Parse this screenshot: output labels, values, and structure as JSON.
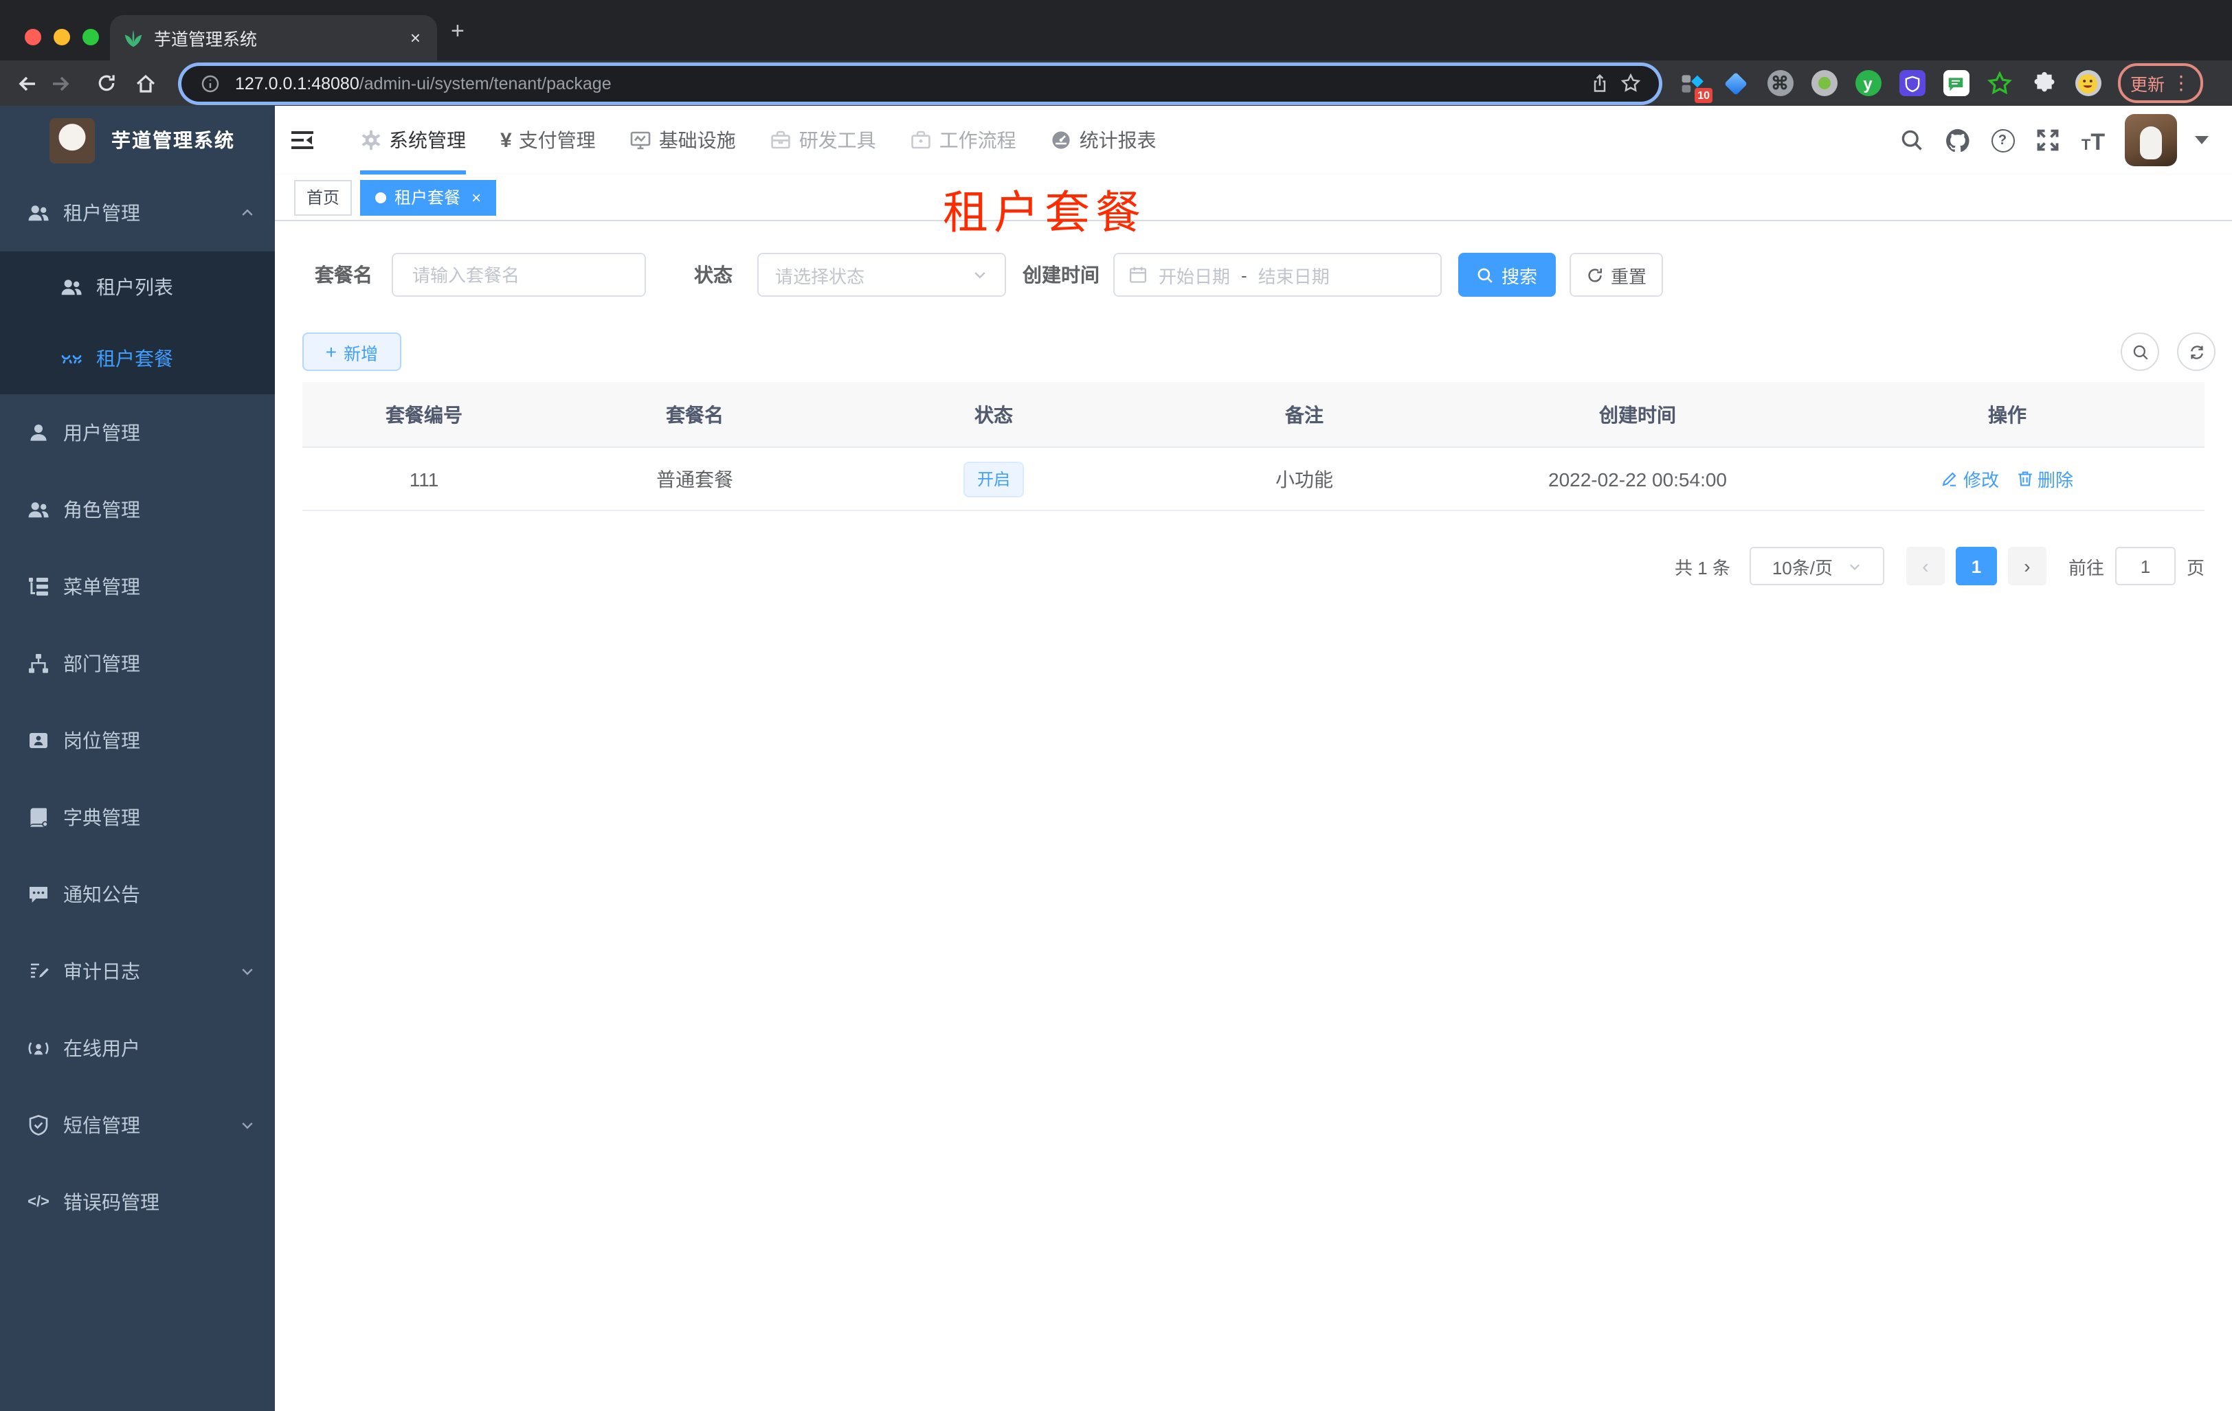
{
  "browser": {
    "tab_title": "芋道管理系统",
    "url": {
      "host": "127.0.0.1:48080",
      "path": "/admin-ui/system/tenant/package"
    },
    "update_button": "更新",
    "extension_badge": "10"
  },
  "glyphs": {
    "plus": "+",
    "close": "×",
    "kebab": "⋮",
    "cmd": "⌘",
    "question": "?",
    "yen": "¥",
    "code": "</>",
    "tt": "T",
    "y": "y",
    "prev": "‹",
    "next": "›",
    "dot": "●"
  },
  "sidebar": {
    "title": "芋道管理系统",
    "items": [
      {
        "label": "租户管理"
      },
      {
        "label": "租户列表"
      },
      {
        "label": "租户套餐"
      },
      {
        "label": "用户管理"
      },
      {
        "label": "角色管理"
      },
      {
        "label": "菜单管理"
      },
      {
        "label": "部门管理"
      },
      {
        "label": "岗位管理"
      },
      {
        "label": "字典管理"
      },
      {
        "label": "通知公告"
      },
      {
        "label": "审计日志"
      },
      {
        "label": "在线用户"
      },
      {
        "label": "短信管理"
      },
      {
        "label": "错误码管理"
      }
    ]
  },
  "topnav": {
    "items": [
      {
        "label": "系统管理"
      },
      {
        "label": "支付管理"
      },
      {
        "label": "基础设施"
      },
      {
        "label": "研发工具"
      },
      {
        "label": "工作流程"
      },
      {
        "label": "统计报表"
      }
    ]
  },
  "tags": [
    {
      "label": "首页"
    },
    {
      "label": "租户套餐"
    }
  ],
  "overlay_title": "租户套餐",
  "filters": {
    "name_label": "套餐名",
    "name_placeholder": "请输入套餐名",
    "status_label": "状态",
    "status_placeholder": "请选择状态",
    "date_label": "创建时间",
    "date_start_placeholder": "开始日期",
    "date_separator": "-",
    "date_end_placeholder": "结束日期",
    "search_button": "搜索",
    "reset_button": "重置"
  },
  "toolbar": {
    "add_button": "新增"
  },
  "table": {
    "headers": [
      "套餐编号",
      "套餐名",
      "状态",
      "备注",
      "创建时间",
      "操作"
    ],
    "rows": [
      {
        "id": "111",
        "name": "普通套餐",
        "status": "开启",
        "remark": "小功能",
        "created_at": "2022-02-22 00:54:00",
        "edit_label": "修改",
        "delete_label": "删除"
      }
    ]
  },
  "pagination": {
    "total": "共 1 条",
    "page_size": "10条/页",
    "current_page": "1",
    "goto_label": "前往",
    "goto_value": "1",
    "goto_suffix": "页"
  },
  "colors": {
    "primary": "#409eff",
    "sidebar_bg": "#304156",
    "submenu_bg": "#1f2d3d",
    "overlay_red": "#ff2b00"
  }
}
